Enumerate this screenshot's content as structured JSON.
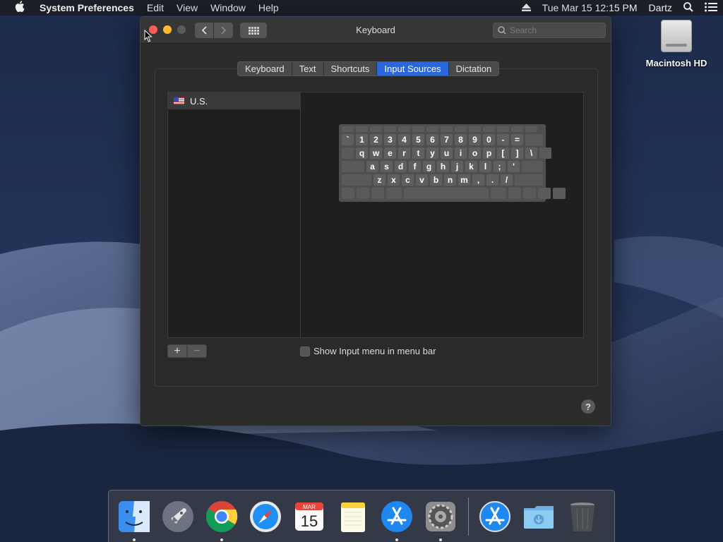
{
  "menubar": {
    "apple": "",
    "app_name": "System Preferences",
    "menus": [
      "Edit",
      "View",
      "Window",
      "Help"
    ],
    "clock": "Tue Mar 15  12:15 PM",
    "user": "Dartz"
  },
  "desktop": {
    "drive_label": "Macintosh HD"
  },
  "window": {
    "title": "Keyboard",
    "search_placeholder": "Search",
    "tabs": [
      {
        "label": "Keyboard",
        "active": false
      },
      {
        "label": "Text",
        "active": false
      },
      {
        "label": "Shortcuts",
        "active": false
      },
      {
        "label": "Input Sources",
        "active": true
      },
      {
        "label": "Dictation",
        "active": false
      }
    ],
    "sources": [
      {
        "label": "U.S."
      }
    ],
    "keyboard_rows": [
      [
        "`",
        "1",
        "2",
        "3",
        "4",
        "5",
        "6",
        "7",
        "8",
        "9",
        "0",
        "-",
        "="
      ],
      [
        "q",
        "w",
        "e",
        "r",
        "t",
        "y",
        "u",
        "i",
        "o",
        "p",
        "[",
        "]",
        "\\"
      ],
      [
        "a",
        "s",
        "d",
        "f",
        "g",
        "h",
        "j",
        "k",
        "l",
        ";",
        "'"
      ],
      [
        "z",
        "x",
        "c",
        "v",
        "b",
        "n",
        "m",
        ",",
        ".",
        "/"
      ]
    ],
    "add_label": "+",
    "remove_label": "−",
    "show_input_menu_label": "Show Input menu in menu bar",
    "show_input_menu_checked": false,
    "help_label": "?"
  },
  "dock": {
    "items": [
      "finder-icon",
      "launchpad-icon",
      "chrome-icon",
      "safari-icon",
      "calendar-icon",
      "notes-icon",
      "app-store-icon",
      "system-preferences-icon",
      "app-store-downloads-icon",
      "downloads-folder-icon",
      "trash-icon"
    ],
    "calendar_month": "MAR",
    "calendar_day": "15"
  },
  "colors": {
    "accent": "#2b67d8",
    "close": "#fd5f57",
    "minimize": "#febc2e"
  }
}
